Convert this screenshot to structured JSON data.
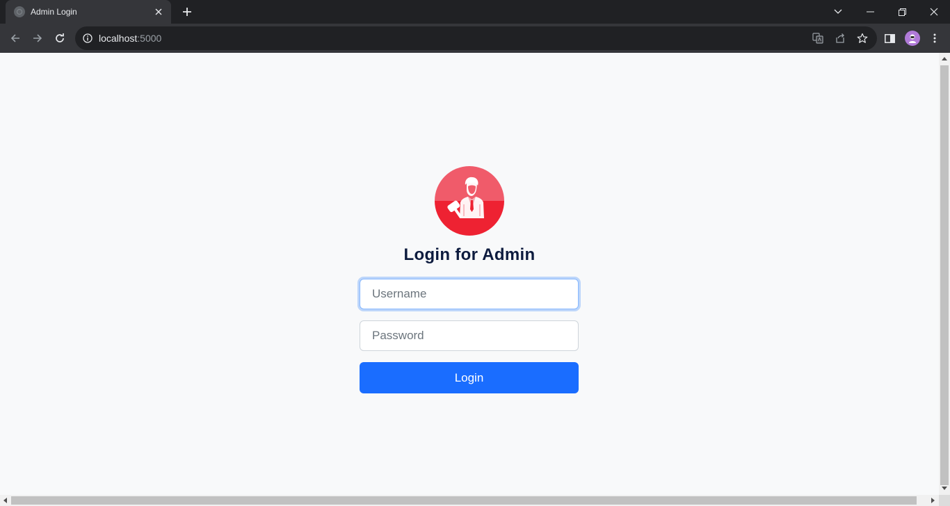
{
  "browser": {
    "tab_title": "Admin Login",
    "url_host": "localhost",
    "url_port": ":5000"
  },
  "page": {
    "title": "Login for Admin",
    "username_placeholder": "Username",
    "password_placeholder": "Password",
    "login_label": "Login",
    "accent_color": "#1a6dff",
    "avatar_color": "#ee2232"
  }
}
